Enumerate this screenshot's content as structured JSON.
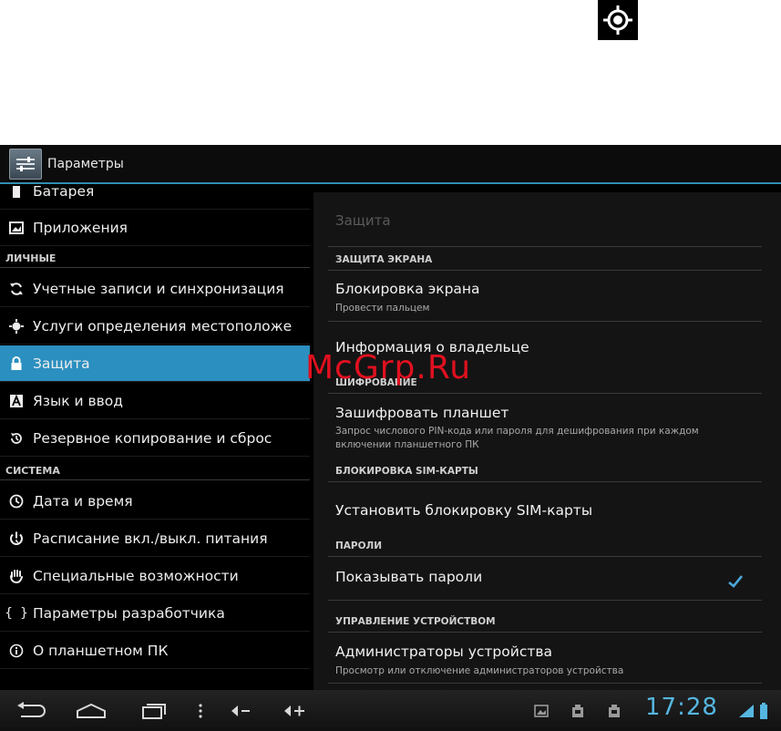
{
  "watermark": "McGrp.Ru",
  "action_bar": {
    "title": "Параметры"
  },
  "left_list": {
    "items_top": [
      {
        "label": "Батарея",
        "icon": "battery-icon"
      },
      {
        "label": "Приложения",
        "icon": "apps-icon"
      }
    ],
    "section_personal": "ЛИЧНЫЕ",
    "items_personal": [
      {
        "label": "Учетные записи и синхронизация",
        "icon": "sync-icon"
      },
      {
        "label": "Услуги определения местоположе",
        "icon": "location-icon"
      },
      {
        "label": "Защита",
        "icon": "lock-icon",
        "active": true
      },
      {
        "label": "Язык и ввод",
        "icon": "language-icon"
      },
      {
        "label": "Резервное копирование и сброс",
        "icon": "backup-icon"
      }
    ],
    "section_system": "СИСТЕМА",
    "items_system": [
      {
        "label": "Дата и время",
        "icon": "clock-icon"
      },
      {
        "label": "Расписание вкл./выкл. питания",
        "icon": "power-schedule-icon"
      },
      {
        "label": "Специальные возможности",
        "icon": "accessibility-icon"
      },
      {
        "label": "Параметры разработчика",
        "icon": "developer-icon"
      },
      {
        "label": "О планшетном ПК",
        "icon": "info-icon"
      }
    ]
  },
  "security": {
    "title": "Защита",
    "screen_section": "ЗАЩИТА ЭКРАНА",
    "screen_lock": {
      "title": "Блокировка экрана",
      "summary": "Провести пальцем"
    },
    "owner_info": {
      "title": "Информация о владельце"
    },
    "encryption_section": "ШИФРОВАНИЕ",
    "encrypt": {
      "title": "Зашифровать планшет",
      "summary": "Запрос числового PIN-кода или пароля для дешифрования при каждом включении планшетного ПК"
    },
    "sim_section": "БЛОКИРОВКА SIM-КАРТЫ",
    "sim_lock": {
      "title": "Установить блокировку SIM-карты"
    },
    "passwords_section": "ПАРОЛИ",
    "show_passwords": {
      "title": "Показывать пароли",
      "checked": true
    },
    "admin_section": "УПРАВЛЕНИЕ УСТРОЙСТВОМ",
    "admins": {
      "title": "Администраторы устройства",
      "summary": "Просмотр или отключение администраторов устройства"
    }
  },
  "status_bar": {
    "time": "17:28"
  },
  "colors": {
    "accent": "#2b8fbf",
    "clock": "#55b6e0",
    "watermark": "#e0101f"
  }
}
